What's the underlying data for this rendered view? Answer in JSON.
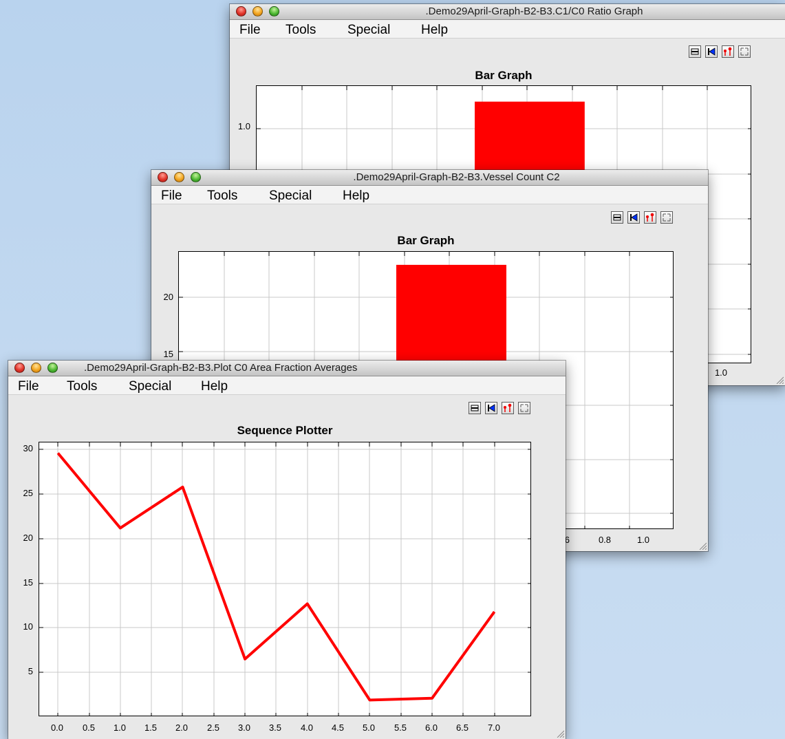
{
  "menus": [
    "File",
    "Tools",
    "Special",
    "Help"
  ],
  "toolbar_icons": [
    "print-icon",
    "rewind-icon",
    "pin-icon",
    "expand-icon"
  ],
  "window_ratio": {
    "title": ".Demo29April-Graph-B2-B3.C1/C0 Ratio Graph",
    "plot_title": "Bar Graph"
  },
  "window_vessel": {
    "title": ".Demo29April-Graph-B2-B3.Vessel Count C2",
    "plot_title": "Bar Graph"
  },
  "window_area": {
    "title": ".Demo29April-Graph-B2-B3.Plot C0 Area Fraction Averages",
    "plot_title": "Sequence Plotter"
  },
  "colors": {
    "series": "#ff0000",
    "grid": "#c8c8c8"
  },
  "chart_data": [
    {
      "id": "ratio",
      "type": "bar",
      "title": "Bar Graph",
      "y_ticks": [
        "1.0"
      ],
      "x_ticks": [
        "1.0"
      ],
      "bar": {
        "x_start": 0.4,
        "x_end": 0.6,
        "value": 1.12
      }
    },
    {
      "id": "vessel",
      "type": "bar",
      "title": "Bar Graph",
      "y_ticks": [
        "20",
        "15"
      ],
      "x_ticks": [
        "6",
        "0.8",
        "1.0"
      ],
      "bar": {
        "x_start": 0.4,
        "x_end": 0.6,
        "value": 23
      }
    },
    {
      "id": "area",
      "type": "line",
      "title": "Sequence Plotter",
      "x": [
        0.0,
        1.0,
        2.0,
        3.0,
        4.0,
        5.0,
        6.0,
        7.0
      ],
      "y": [
        29.6,
        21.2,
        25.8,
        6.5,
        12.7,
        1.9,
        2.1,
        11.8
      ],
      "xlim": [
        -0.3,
        7.6
      ],
      "ylim": [
        0,
        30.8
      ],
      "x_ticks": [
        "0.0",
        "0.5",
        "1.0",
        "1.5",
        "2.0",
        "2.5",
        "3.0",
        "3.5",
        "4.0",
        "4.5",
        "5.0",
        "5.5",
        "6.0",
        "6.5",
        "7.0"
      ],
      "y_ticks": [
        "30",
        "25",
        "20",
        "15",
        "10",
        "5"
      ]
    }
  ]
}
